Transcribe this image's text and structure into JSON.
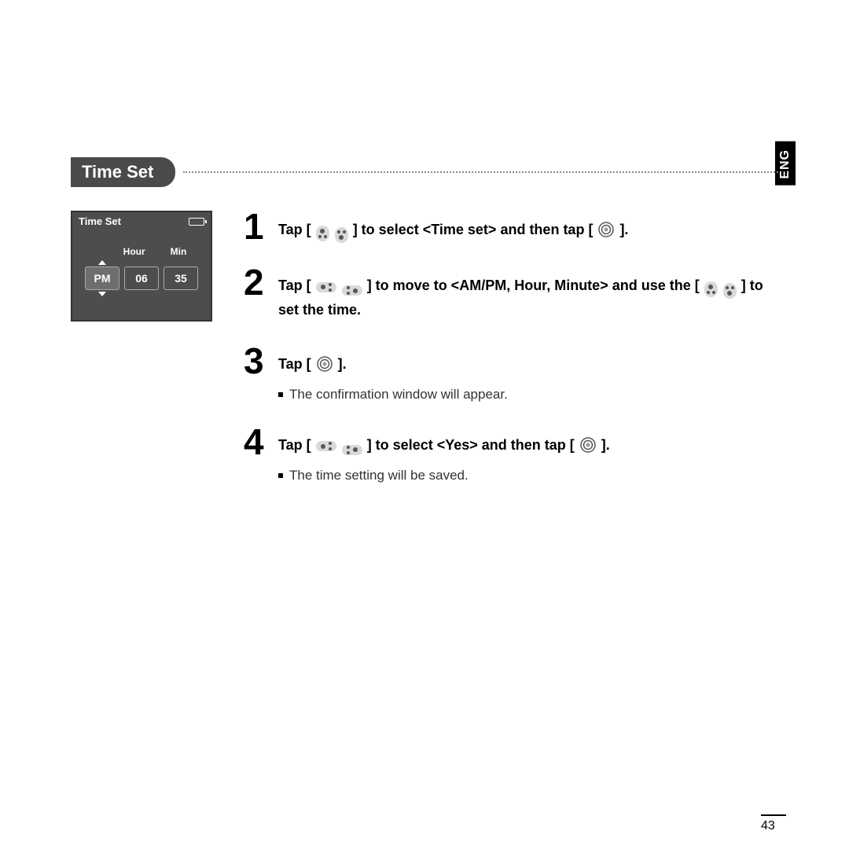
{
  "lang_tab": "ENG",
  "section_title": "Time Set",
  "device": {
    "title": "Time Set",
    "hour_label": "Hour",
    "min_label": "Min",
    "ampm": "PM",
    "hour": "06",
    "minute": "35"
  },
  "steps": [
    {
      "num": "1",
      "parts": [
        "Tap [ ",
        {
          "icon": "dots-up"
        },
        " ",
        {
          "icon": "dots-down"
        },
        " ] to select <Time set> and then tap [ ",
        {
          "icon": "select"
        },
        " ]."
      ],
      "subs": []
    },
    {
      "num": "2",
      "parts": [
        "Tap [ ",
        {
          "icon": "dots-left"
        },
        " ",
        {
          "icon": "dots-right"
        },
        " ] to move to <AM/PM, Hour, Minute> and use the [ ",
        {
          "icon": "dots-up"
        },
        " ",
        {
          "icon": "dots-down"
        },
        " ] to set the time."
      ],
      "subs": []
    },
    {
      "num": "3",
      "parts": [
        "Tap [ ",
        {
          "icon": "select"
        },
        " ]."
      ],
      "subs": [
        "The confirmation window will appear."
      ]
    },
    {
      "num": "4",
      "parts": [
        "Tap [ ",
        {
          "icon": "dots-left"
        },
        " ",
        {
          "icon": "dots-right"
        },
        " ] to select <Yes> and then tap [ ",
        {
          "icon": "select"
        },
        " ]."
      ],
      "subs": [
        "The time setting will be saved."
      ]
    }
  ],
  "page_number": "43"
}
